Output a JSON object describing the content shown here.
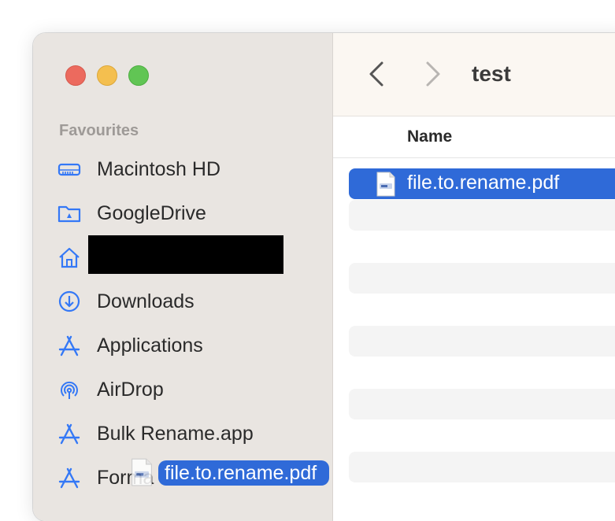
{
  "window": {
    "title": "test"
  },
  "sidebar": {
    "section_title": "Favourites",
    "items": [
      {
        "label": "Macintosh HD",
        "icon": "harddrive-icon"
      },
      {
        "label": "GoogleDrive",
        "icon": "folder-drive-icon"
      },
      {
        "label": "",
        "icon": "home-icon",
        "redacted": true
      },
      {
        "label": "Downloads",
        "icon": "download-icon"
      },
      {
        "label": "Applications",
        "icon": "applications-icon"
      },
      {
        "label": "AirDrop",
        "icon": "airdrop-icon"
      },
      {
        "label": "Bulk Rename.app",
        "icon": "applications-icon"
      },
      {
        "label": "Forma",
        "icon": "applications-icon"
      }
    ]
  },
  "main": {
    "column_header": "Name",
    "rows": [
      {
        "name": "file.to.rename.pdf",
        "icon": "pdf-file-icon",
        "selected": true
      }
    ]
  },
  "drag": {
    "label": "file.to.rename.pdf",
    "icon": "pdf-file-icon"
  },
  "colors": {
    "accent": "#2f6ad8",
    "sidebar_bg": "#e9e5e1",
    "icon_blue": "#3478f6"
  }
}
